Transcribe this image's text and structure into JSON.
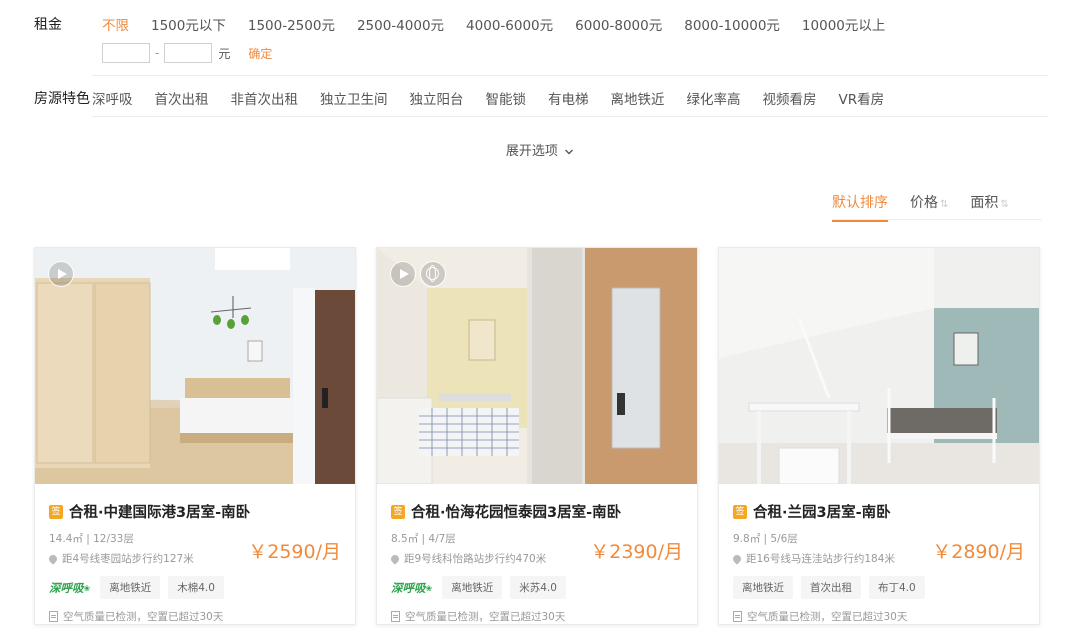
{
  "filters": {
    "rent": {
      "label": "租金",
      "options": [
        "不限",
        "1500元以下",
        "1500-2500元",
        "2500-4000元",
        "4000-6000元",
        "6000-8000元",
        "8000-10000元",
        "10000元以上"
      ],
      "active_index": 0,
      "custom": {
        "min_value": "",
        "max_value": "",
        "dash": "-",
        "unit": "元",
        "confirm": "确定"
      }
    },
    "features": {
      "label": "房源特色",
      "options": [
        "深呼吸",
        "首次出租",
        "非首次出租",
        "独立卫生间",
        "独立阳台",
        "智能锁",
        "有电梯",
        "离地铁近",
        "绿化率高",
        "视频看房",
        "VR看房"
      ]
    },
    "expand_label": "展开选项",
    "expand_icon": "chevron-down-icon"
  },
  "sort": {
    "items": [
      "默认排序",
      "价格",
      "面积"
    ],
    "active_index": 0
  },
  "listings": [
    {
      "title": "合租·中建国际港3居室-南卧",
      "meta": "14.4㎡ | 12/33层",
      "distance": "距4号线枣园站步行约127米",
      "price": "￥2590/月",
      "tags": [
        "深呼吸",
        "离地铁近",
        "木棉4.0"
      ],
      "air": "空气质量已检测，空置已超过30天",
      "badges": [
        "play"
      ],
      "sign_icon": "签"
    },
    {
      "title": "合租·怡海花园恒泰园3居室-南卧",
      "meta": "8.5㎡ | 4/7层",
      "distance": "距9号线科怡路站步行约470米",
      "price": "￥2390/月",
      "tags": [
        "深呼吸",
        "离地铁近",
        "米苏4.0"
      ],
      "air": "空气质量已检测，空置已超过30天",
      "badges": [
        "play",
        "vr"
      ],
      "sign_icon": "签"
    },
    {
      "title": "合租·兰园3居室-南卧",
      "meta": "9.8㎡ | 5/6层",
      "distance": "距16号线马连洼站步行约184米",
      "price": "￥2890/月",
      "tags": [
        "离地铁近",
        "首次出租",
        "布丁4.0"
      ],
      "air": "空气质量已检测，空置已超过30天",
      "badges": [],
      "sign_icon": "签"
    }
  ],
  "colors": {
    "accent": "#f08a3c",
    "green": "#2ea44f"
  }
}
